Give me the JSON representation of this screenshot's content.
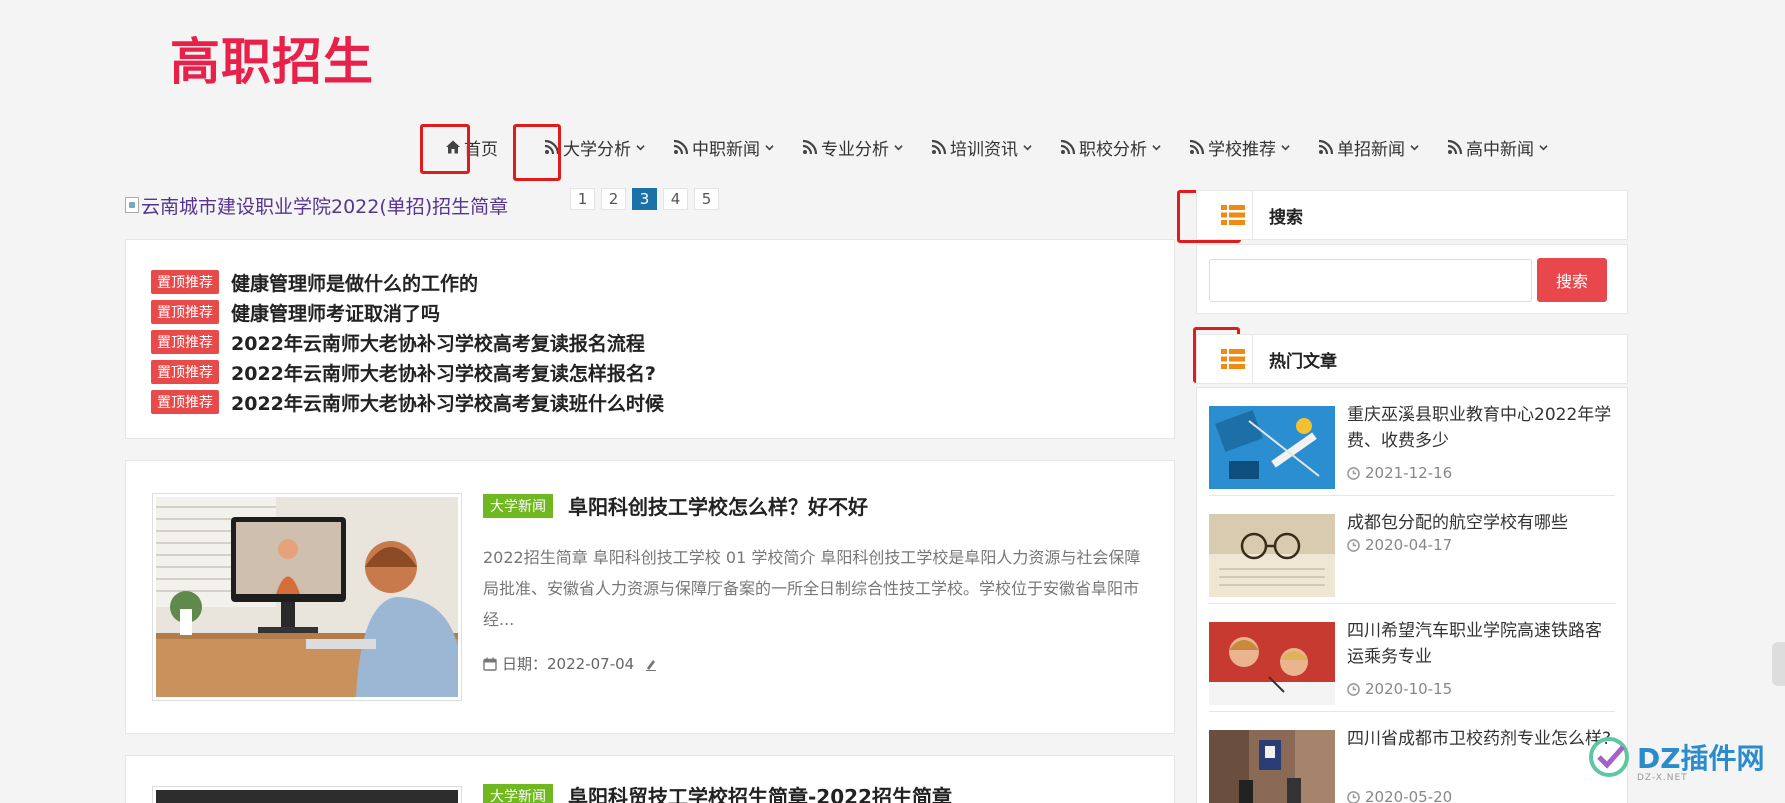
{
  "site": {
    "logo": "高职招生"
  },
  "nav": [
    {
      "label": "首页",
      "icon": "home-icon",
      "dropdown": false
    },
    {
      "label": "大学分析",
      "icon": "rss-icon",
      "dropdown": true
    },
    {
      "label": "中职新闻",
      "icon": "rss-icon",
      "dropdown": true
    },
    {
      "label": "专业分析",
      "icon": "rss-icon",
      "dropdown": true
    },
    {
      "label": "培训资讯",
      "icon": "rss-icon",
      "dropdown": true
    },
    {
      "label": "职校分析",
      "icon": "rss-icon",
      "dropdown": true
    },
    {
      "label": "学校推荐",
      "icon": "rss-icon",
      "dropdown": true
    },
    {
      "label": "单招新闻",
      "icon": "rss-icon",
      "dropdown": true
    },
    {
      "label": "高中新闻",
      "icon": "rss-icon",
      "dropdown": true
    }
  ],
  "slider": {
    "alt": "云南城市建设职业学院2022(单招)招生简章",
    "pages": [
      "1",
      "2",
      "3",
      "4",
      "5"
    ],
    "active_page": "3"
  },
  "top_posts": {
    "tag": "置顶推荐",
    "items": [
      "健康管理师是做什么的工作的",
      "健康管理师考证取消了吗",
      "2022年云南师大老协补习学校高考复读报名流程",
      "2022年云南师大老协补习学校高考复读怎样报名?",
      "2022年云南师大老协补习学校高考复读班什么时候"
    ]
  },
  "posts": [
    {
      "tag": "大学新闻",
      "title": "阜阳科创技工学校怎么样？好不好",
      "excerpt": "2022招生简章 阜阳科创技工学校 01 学校简介 阜阳科创技工学校是阜阳人力资源与社会保障局批准、安徽省人力资源与保障厅备案的一所全日制综合性技工学校。学校位于安徽省阜阳市经...",
      "date_label": "日期：",
      "date": "2022-07-04"
    },
    {
      "tag": "大学新闻",
      "title": "阜阳科贸技工学校招生简章-2022招生简章"
    }
  ],
  "sidebar": {
    "search": {
      "title": "搜索",
      "button": "搜索",
      "placeholder": ""
    },
    "hot": {
      "title": "热门文章",
      "items": [
        {
          "title": "重庆巫溪县职业教育中心2022年学费、收费多少",
          "date": "2021-12-16"
        },
        {
          "title": "成都包分配的航空学校有哪些",
          "date": "2020-04-17"
        },
        {
          "title": "四川希望汽车职业学院高速铁路客运乘务专业",
          "date": "2020-10-15"
        },
        {
          "title": "四川省成都市卫校药剂专业怎么样?",
          "date": "2020-05-20"
        }
      ]
    }
  },
  "watermark": {
    "text": "DZ插件网",
    "sub": "DZ-X.NET"
  },
  "colors": {
    "logo": "#e8214a",
    "tag_red": "#e84a4a",
    "tag_green": "#70b821",
    "accent_blue": "#1c72a8",
    "search_btn": "#e8474c",
    "highlight_box": "#e01b1b",
    "widget_icon": "#f08a12"
  }
}
